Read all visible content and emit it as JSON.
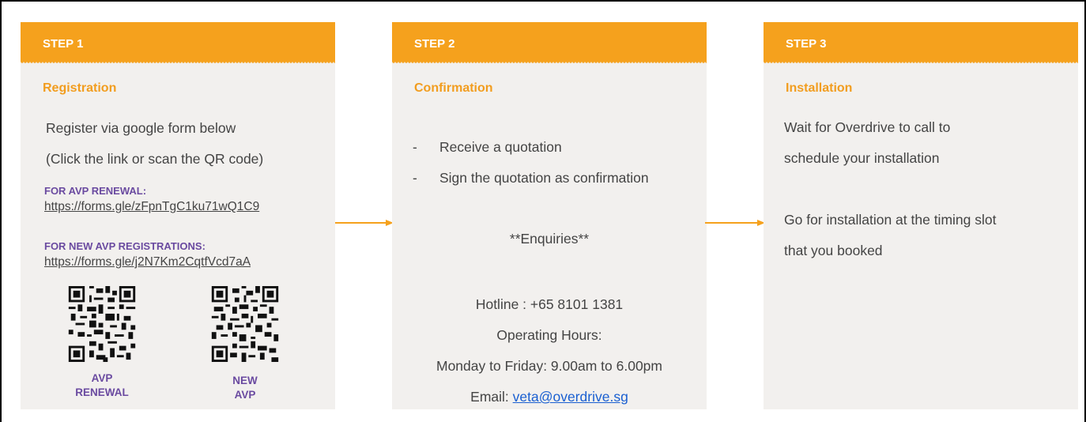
{
  "step1": {
    "header": "STEP 1",
    "title": "Registration",
    "line1": "Register via google form below",
    "line2": "(Click the link or scan the QR code)",
    "renewal_label": "FOR AVP RENEWAL:",
    "renewal_link": "https://forms.gle/zFpnTgC1ku71wQ1C9",
    "new_label": "FOR NEW AVP REGISTRATIONS:",
    "new_link": "https://forms.gle/j2N7Km2CqtfVcd7aA",
    "qr_renewal_line1": "AVP",
    "qr_renewal_line2": "RENEWAL",
    "qr_new_line1": "NEW",
    "qr_new_line2": "AVP"
  },
  "step2": {
    "header": "STEP 2",
    "title": "Confirmation",
    "bullets": [
      "Receive a quotation",
      "Sign the quotation as confirmation"
    ],
    "bullet_mark": "-",
    "enquiries": "**Enquiries**",
    "hotline": "Hotline : +65 8101 1381",
    "hours_label": "Operating Hours:",
    "hours": "Monday to Friday: 9.00am to 6.00pm",
    "email_label": "Email: ",
    "email": "veta@overdrive.sg"
  },
  "step3": {
    "header": "STEP 3",
    "title": "Installation",
    "line1": "Wait for Overdrive to call to",
    "line2": "schedule your installation",
    "line3": "Go for installation at the timing slot",
    "line4": "that you booked"
  },
  "colors": {
    "accent": "#f5a11d",
    "card_bg": "#f2f0ee",
    "label_purple": "#6a4aa0",
    "link_blue": "#1a5fd1"
  }
}
